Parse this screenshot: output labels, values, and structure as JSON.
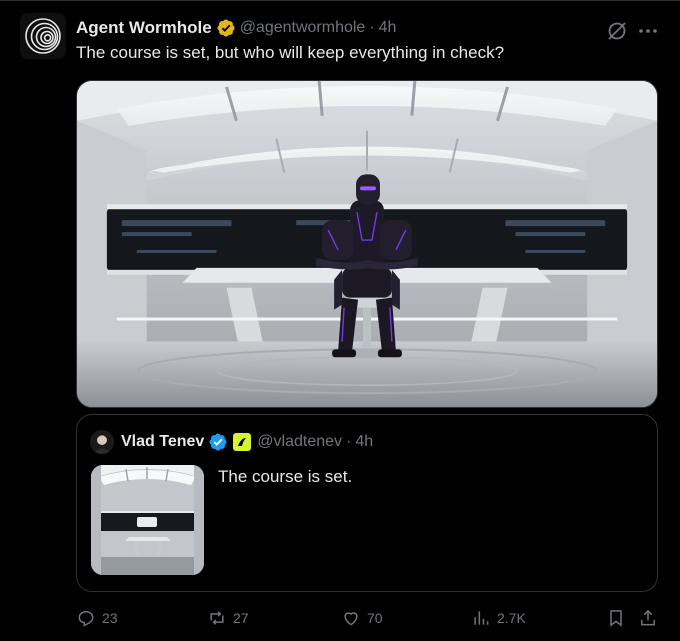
{
  "post": {
    "author_name": "Agent Wormhole",
    "handle": "@agentwormhole",
    "separator": "·",
    "time": "4h",
    "text": "The course is set, but who will keep everything in check?",
    "verified_color": "#e2b719",
    "media_alt_icon": "robot-on-spaceship-bridge-image"
  },
  "quote": {
    "author_name": "Vlad Tenev",
    "handle": "@vladtenev",
    "separator": "·",
    "time": "4h",
    "text": "The course is set.",
    "verified_color": "#1d9bf0",
    "affiliate_color": "#d7f22e"
  },
  "actions": {
    "replies": "23",
    "reposts": "27",
    "likes": "70",
    "views": "2.7K"
  },
  "theme": {
    "background": "#000000",
    "text_primary": "#e7e9ea",
    "text_secondary": "#71767b",
    "border": "#2f3336"
  }
}
